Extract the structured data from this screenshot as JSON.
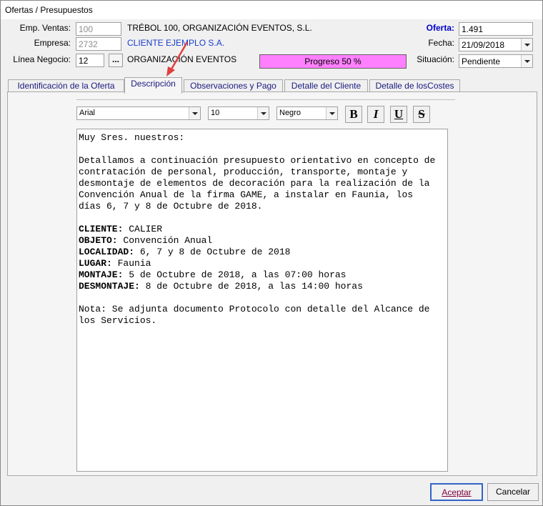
{
  "window": {
    "title": "Ofertas / Presupuestos"
  },
  "header": {
    "emp_ventas": {
      "label": "Emp. Ventas:",
      "code": "100",
      "name": "TRÉBOL 100, ORGANIZACIÓN EVENTOS, S.L."
    },
    "empresa": {
      "label": "Empresa:",
      "code": "2732",
      "name": "CLIENTE EJEMPLO S.A."
    },
    "linea": {
      "label": "Línea Negocio:",
      "code": "12",
      "dots": "...",
      "name": "ORGANIZACIÓN EVENTOS"
    },
    "progress": {
      "label": "Progreso  50 %",
      "value": 50
    },
    "oferta": {
      "label": "Oferta:",
      "value": "1.491"
    },
    "fecha": {
      "label": "Fecha:",
      "value": "21/09/2018"
    },
    "situacion": {
      "label": "Situación:",
      "value": "Pendiente"
    }
  },
  "tabs": [
    {
      "label": "Identificación de la Oferta"
    },
    {
      "label": "Descripción",
      "active": true
    },
    {
      "label": "Observaciones y Pago"
    },
    {
      "label": "Detalle del Cliente"
    },
    {
      "label": "Detalle de losCostes"
    }
  ],
  "toolbar": {
    "font": "Arial",
    "size": "10",
    "color": "Negro",
    "bold": "B",
    "italic": "I",
    "underline": "U",
    "strike": "S"
  },
  "editor": {
    "lines": [
      {
        "text": "Muy Sres. nuestros:"
      },
      {
        "text": ""
      },
      {
        "text": "Detallamos a continuación presupuesto orientativo en concepto de"
      },
      {
        "text": "contratación de personal, producción, transporte, montaje y"
      },
      {
        "text": "desmontaje de elementos de decoración para la realización de la"
      },
      {
        "text": "Convención Anual de la firma GAME, a instalar en Faunia, los"
      },
      {
        "text": "días 6, 7 y 8 de Octubre de 2018."
      },
      {
        "text": ""
      },
      {
        "bold": "CLIENTE:",
        "text": " CALIER"
      },
      {
        "bold": "OBJETO:",
        "text": " Convención Anual"
      },
      {
        "bold": "LOCALIDAD:",
        "text": " 6, 7 y 8 de Octubre de 2018"
      },
      {
        "bold": "LUGAR:",
        "text": " Faunia"
      },
      {
        "bold": "MONTAJE:",
        "text": " 5 de Octubre de 2018, a las 07:00 horas"
      },
      {
        "bold": "DESMONTAJE:",
        "text": " 8 de Octubre de 2018, a las 14:00 horas"
      },
      {
        "text": ""
      },
      {
        "text": "Nota: Se adjunta documento Protocolo con detalle del Alcance de"
      },
      {
        "text": "los Servicios."
      }
    ]
  },
  "footer": {
    "accept": "Aceptar",
    "cancel": "Cancelar"
  },
  "colors": {
    "progress": "#ff80ff",
    "accent": "#0000cc",
    "annotation": "#e04040"
  }
}
